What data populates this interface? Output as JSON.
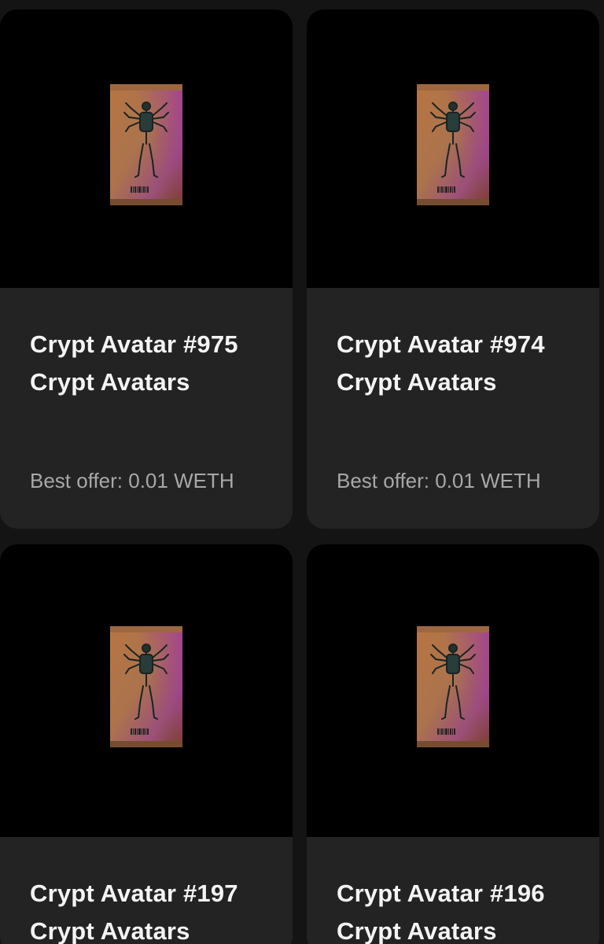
{
  "cards": [
    {
      "title": "Crypt Avatar #975",
      "collection": "Crypt Avatars",
      "offer": "Best offer: 0.01 WETH"
    },
    {
      "title": "Crypt Avatar #974",
      "collection": "Crypt Avatars",
      "offer": "Best offer: 0.01 WETH"
    },
    {
      "title": "Crypt Avatar #197",
      "collection": "Crypt Avatars"
    },
    {
      "title": "Crypt Avatar #196",
      "collection": "Crypt Avatars"
    }
  ],
  "colors": {
    "page_background": "#141414",
    "card_background": "#232323",
    "thumbnail_background": "#000000",
    "title_text": "#f4f4f4",
    "offer_text": "#a8a8a8"
  },
  "icons": {
    "nft_image": "card-pack-image"
  }
}
